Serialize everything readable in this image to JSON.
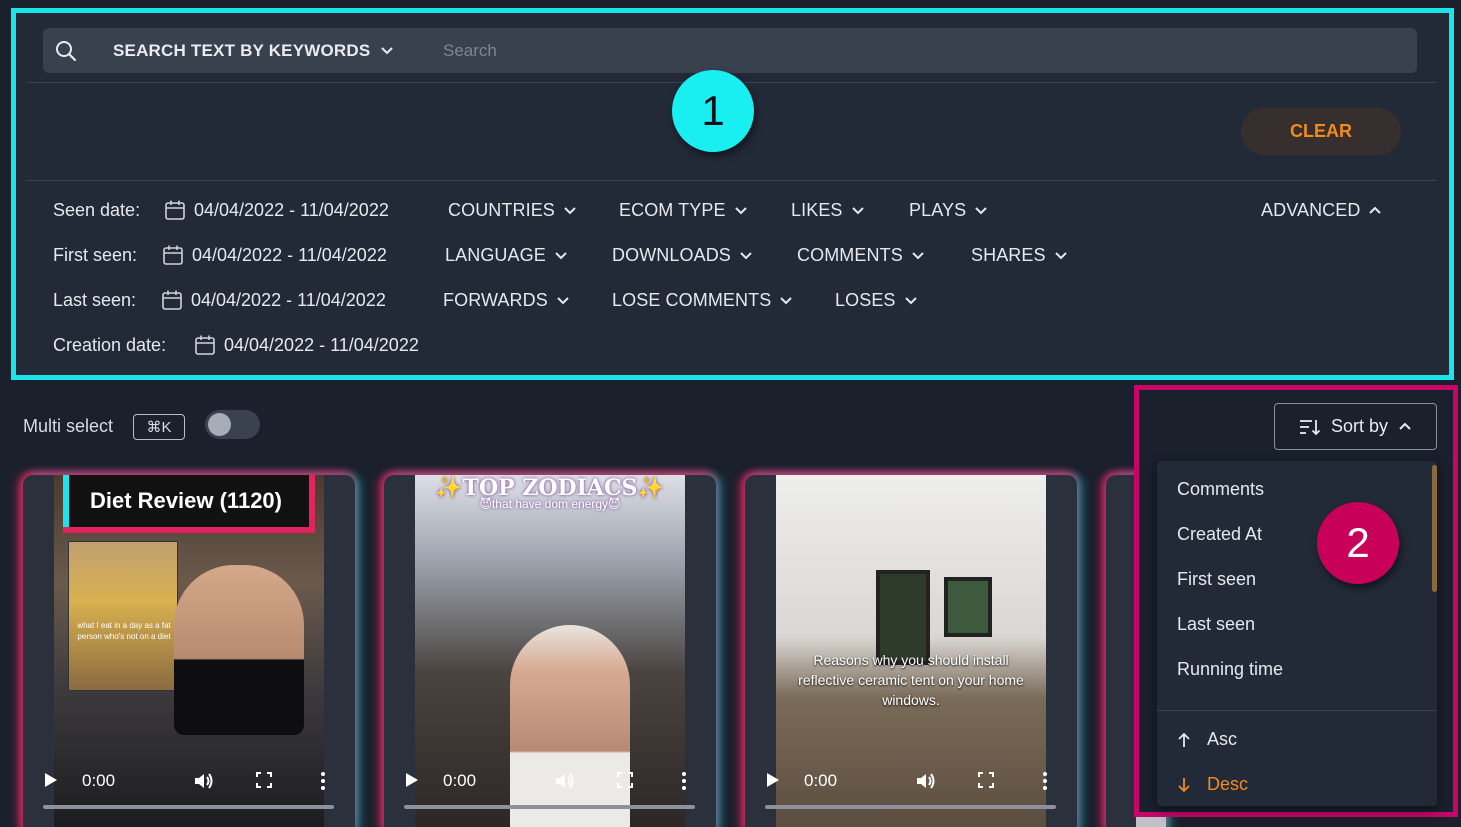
{
  "search": {
    "mode_label": "SEARCH TEXT BY KEYWORDS",
    "placeholder": "Search"
  },
  "annotations": {
    "badge_1": "1",
    "badge_2": "2"
  },
  "clear_label": "CLEAR",
  "filters": {
    "seen_date": {
      "label": "Seen date:",
      "value": "04/04/2022 - 11/04/2022"
    },
    "first_seen": {
      "label": "First seen:",
      "value": "04/04/2022 - 11/04/2022"
    },
    "last_seen": {
      "label": "Last seen:",
      "value": "04/04/2022 - 11/04/2022"
    },
    "creation_date": {
      "label": "Creation date:",
      "value": "04/04/2022 - 11/04/2022"
    },
    "dropdowns": {
      "countries": "COUNTRIES",
      "ecom_type": "ECOM TYPE",
      "likes": "LIKES",
      "plays": "PLAYS",
      "language": "LANGUAGE",
      "downloads": "DOWNLOADS",
      "comments": "COMMENTS",
      "shares": "SHARES",
      "forwards": "FORWARDS",
      "lose_comments": "LOSE COMMENTS",
      "loses": "LOSES"
    },
    "advanced_label": "ADVANCED"
  },
  "multi_select": {
    "label": "Multi select",
    "shortcut": "⌘K",
    "enabled": false
  },
  "cards": [
    {
      "overlay_title": "Diet Review (1120)",
      "caption": "what I eat in a day as a fat person who's not on a diet",
      "time": "0:00"
    },
    {
      "overlay_title": "✨TOP ZODIACS✨",
      "overlay_subtitle": "😈that have dom energy😈",
      "time": "0:00"
    },
    {
      "caption": "Reasons why you should install reflective ceramic tent on your home windows.",
      "time": "0:00"
    },
    {
      "time": ""
    }
  ],
  "sort": {
    "button_label": "Sort by",
    "options": [
      "Comments",
      "Created At",
      "First seen",
      "Last seen",
      "Running time"
    ],
    "asc_label": "Asc",
    "desc_label": "Desc",
    "selected_direction": "Desc"
  },
  "colors": {
    "highlight_cyan": "#19e5ea",
    "highlight_magenta": "#c8066a",
    "accent_orange": "#f28a1c",
    "background": "#1a202c"
  }
}
